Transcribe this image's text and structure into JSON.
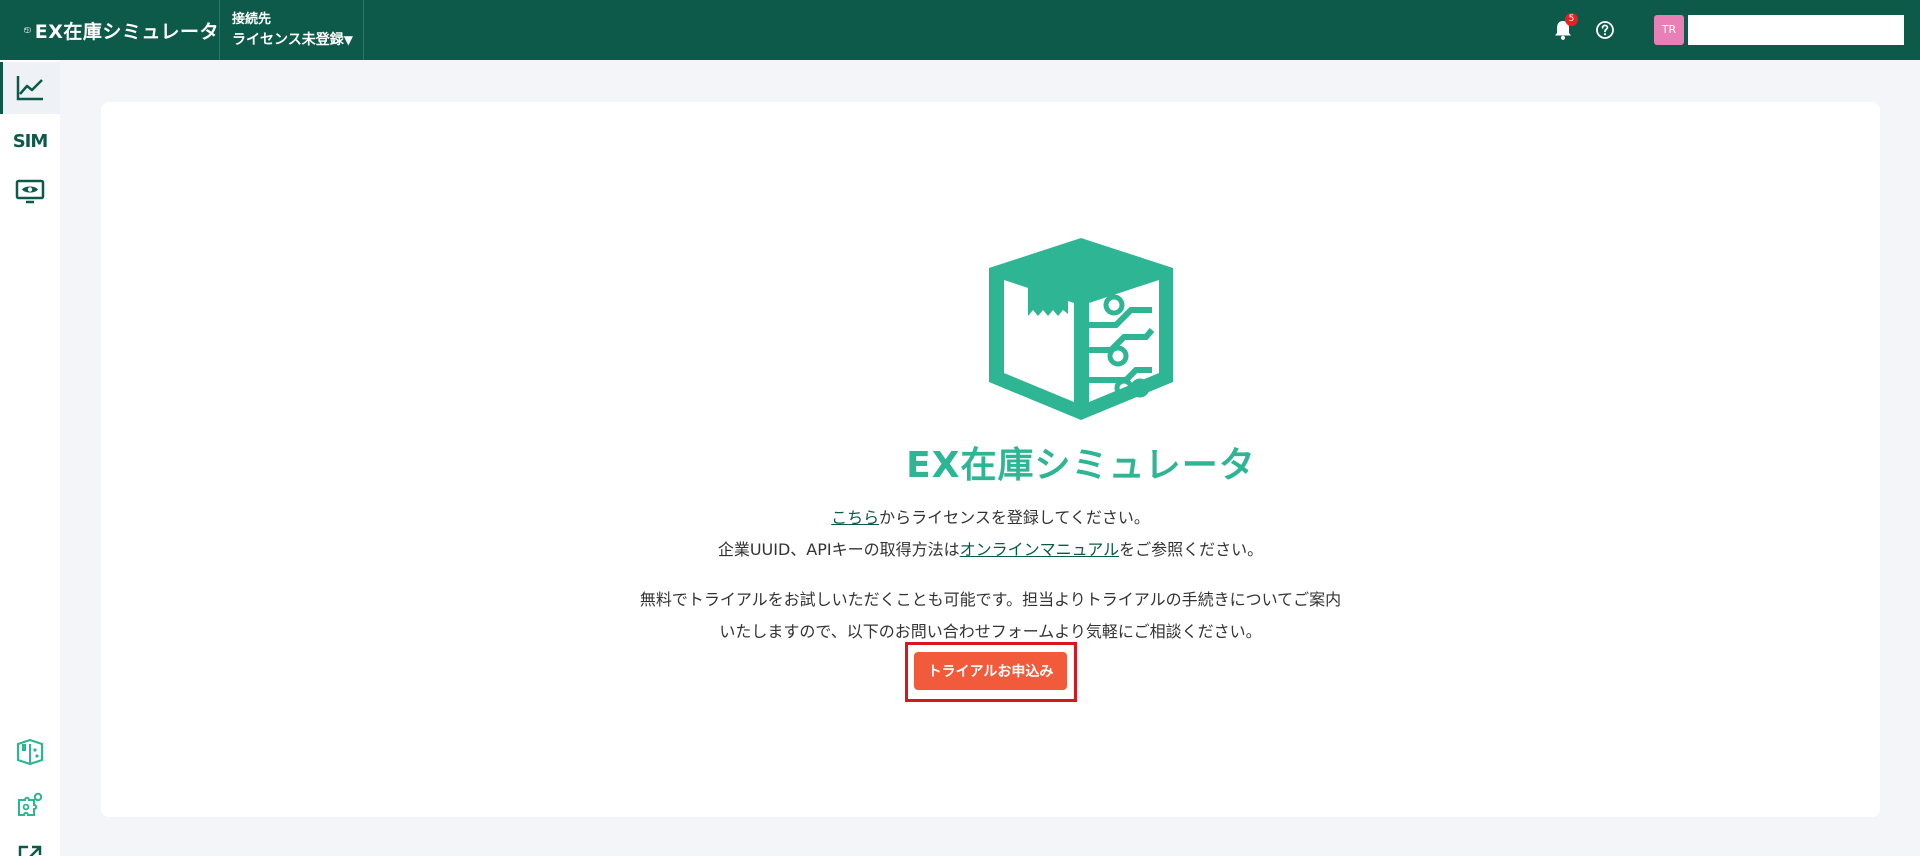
{
  "header": {
    "app_name": "EX在庫シミュレータ",
    "connection_label": "接続先",
    "connection_value": "ライセンス未登録",
    "notification_count": "5",
    "avatar_initials": "TR",
    "colors": {
      "header_bg": "#0d5a4a",
      "badge": "#e02424",
      "avatar": "#e87fb6"
    }
  },
  "sidebar": {
    "items": [
      {
        "icon": "chart-line-icon",
        "active": true
      },
      {
        "icon": "sim-icon",
        "label": "SIM"
      },
      {
        "icon": "monitor-eye-icon"
      },
      {
        "icon": "cube-circuit-icon"
      },
      {
        "icon": "puzzle-gears-icon"
      },
      {
        "icon": "external-link-icon"
      }
    ]
  },
  "main": {
    "logo_text": "EX在庫シミュレータ",
    "line1_link": "こちら",
    "line1_rest": "からライセンスを登録してください。",
    "line2_prefix": "企業UUID、APIキーの取得方法は",
    "line2_link": "オンラインマニュアル",
    "line2_suffix": "をご参照ください。",
    "line3": "無料でトライアルをお試しいただくことも可能です。担当よりトライアルの手続きについてご案内",
    "line4": "いたしますので、以下のお問い合わせフォームより気軽にご相談ください。",
    "trial_button": "トライアルお申込み",
    "colors": {
      "accent": "#2eb594",
      "button": "#f15a3a",
      "highlight_frame": "#d9161c"
    }
  }
}
